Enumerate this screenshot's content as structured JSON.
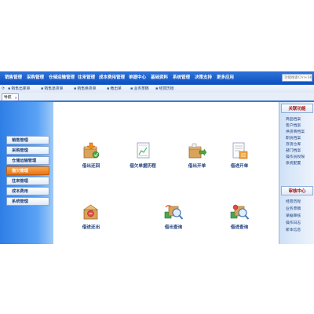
{
  "menubar": {
    "items": [
      "销售管理",
      "采购管理",
      "仓储运输管理",
      "往来管理",
      "成本费用管理",
      "单据中心",
      "基础资料",
      "系统管理",
      "决策支持",
      "更多应用"
    ],
    "search_placeholder": "功能搜索Ctrl+Sh"
  },
  "quick_links": [
    "销售出库单",
    "销售退货单",
    "销售换货单",
    "缴出单",
    "业务草稿",
    "经营历程"
  ],
  "tab": {
    "label": "导航"
  },
  "sidebar": {
    "items": [
      {
        "label": "销售管理",
        "active": false
      },
      {
        "label": "采购管理",
        "active": false
      },
      {
        "label": "仓储运输管理",
        "active": false
      },
      {
        "label": "借欠管理",
        "active": true
      },
      {
        "label": "往来管理",
        "active": false
      },
      {
        "label": "成本费用",
        "active": false
      },
      {
        "label": "系统管理",
        "active": false
      }
    ]
  },
  "shortcuts": [
    {
      "label": "借出还回",
      "icon": "return-box-icon"
    },
    {
      "label": "借欠单据历程",
      "icon": "document-chart-icon"
    },
    {
      "label": "借出开单",
      "icon": "outbound-box-icon"
    },
    {
      "label": "借进开单",
      "icon": "inbound-document-icon"
    },
    {
      "label": "借进还出",
      "icon": "return-out-box-icon"
    },
    {
      "label": "借出查询",
      "icon": "lend-query-icon"
    },
    {
      "label": "借进查询",
      "icon": "borrow-query-icon"
    }
  ],
  "right_panel": {
    "related_title": "关联功能",
    "related_items": [
      "商品档案",
      "客户档案",
      "供货商档案",
      "职员档案",
      "存货仓库",
      "部门档案",
      "操作员权限",
      "系统配置"
    ],
    "audit_title": "审核中心",
    "audit_items": [
      "经营历程",
      "业务草稿",
      "单据审核",
      "操作日志",
      "新本信息"
    ]
  },
  "colors": {
    "menu_blue": "#0b4fc0",
    "active_orange": "#e9761b",
    "label_blue": "#1d3e7e"
  }
}
